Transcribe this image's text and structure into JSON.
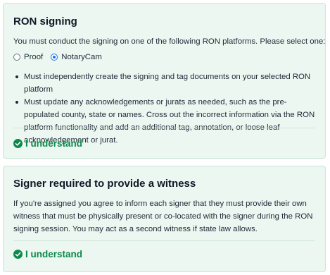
{
  "ron_signing": {
    "title": "RON signing",
    "intro": "You must conduct the signing on one of the following RON platforms. Please select one:",
    "platforms": [
      {
        "label": "Proof",
        "selected": false
      },
      {
        "label": "NotaryCam",
        "selected": true
      }
    ],
    "bullets": [
      "Must independently create the signing and tag documents on your selected RON platform",
      "Must update any acknowledgements or jurats as needed, such as the pre-populated county, state or names. Cross out the incorrect information via the RON platform functionality and add an additional tag, annotation, or loose leaf acknowledgement or jurat."
    ],
    "understand_label": "I understand"
  },
  "witness": {
    "title": "Signer required to provide a witness",
    "body": "If you're assigned you agree to inform each signer that they must provide their own witness that must be physically present or co-located with the signer during the RON signing session. You may act as a second witness if state law allows.",
    "understand_label": "I understand"
  },
  "colors": {
    "card_background": "#ecf7f1",
    "card_border": "#c9e6d6",
    "accent_green": "#0b8a4a",
    "radio_selected": "#1a73e8"
  },
  "icons": {
    "understand": "check-circle-icon"
  }
}
